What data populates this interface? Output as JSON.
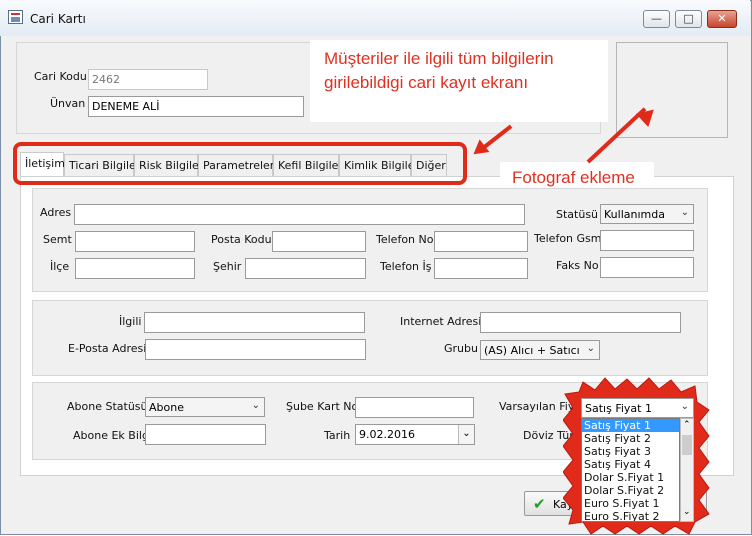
{
  "window": {
    "title": "Cari Kartı",
    "min": "▭",
    "max": "▢",
    "close": "✕"
  },
  "header": {
    "cari_kodu_label": "Cari Kodu",
    "cari_kodu_value": "2462",
    "unvan_label": "Ünvan",
    "unvan_value": "DENEME ALİ"
  },
  "annotations": {
    "note1_line1": "Müşteriler ile ilgili tüm bilgilerin",
    "note1_line2": "girilebildigi cari kayıt ekranı",
    "note2": "Fotograf ekleme",
    "color": "#e02a1a"
  },
  "tabs": [
    "İletişim",
    "Ticari Bilgiler",
    "Risk Bilgileri",
    "Parametreler",
    "Kefil Bilgileri",
    "Kimlik Bilgileri",
    "Diğer"
  ],
  "contact": {
    "adres": "Adres",
    "statusu": "Statüsü",
    "statusu_value": "Kullanımda",
    "semt": "Semt",
    "posta_kodu": "Posta Kodu",
    "telefon_no": "Telefon No",
    "telefon_gsm": "Telefon Gsm",
    "ilce": "İlçe",
    "sehir": "Şehir",
    "telefon_is": "Telefon İş",
    "faks_no": "Faks No"
  },
  "misc": {
    "ilgili": "İlgili",
    "internet_adresi": "Internet Adresi",
    "eposta": "E-Posta Adresi",
    "grubu": "Grubu",
    "grubu_value": "(AS) Alıcı + Satıcı"
  },
  "subscription": {
    "abone_statusu": "Abone Statüsü",
    "abone_statusu_value": "Abone",
    "sube_kart_no": "Şube Kart No",
    "varsayilan_fiyat": "Varsayılan Fiyat",
    "varsayilan_fiyat_value": "Satış Fiyat 1",
    "abone_ek_bilgi": "Abone Ek Bilgi",
    "tarih": "Tarih",
    "tarih_value": "9.02.2016",
    "doviz_turu": "Döviz Türü"
  },
  "price_options": [
    "Satış Fiyat 1",
    "Satış Fiyat 2",
    "Satış Fiyat 3",
    "Satış Fiyat 4",
    "Dolar S.Fiyat 1",
    "Dolar S.Fiyat 2",
    "Euro S.Fiyat 1",
    "Euro S.Fiyat 2"
  ],
  "footer": {
    "save_label": "Kaydet"
  }
}
